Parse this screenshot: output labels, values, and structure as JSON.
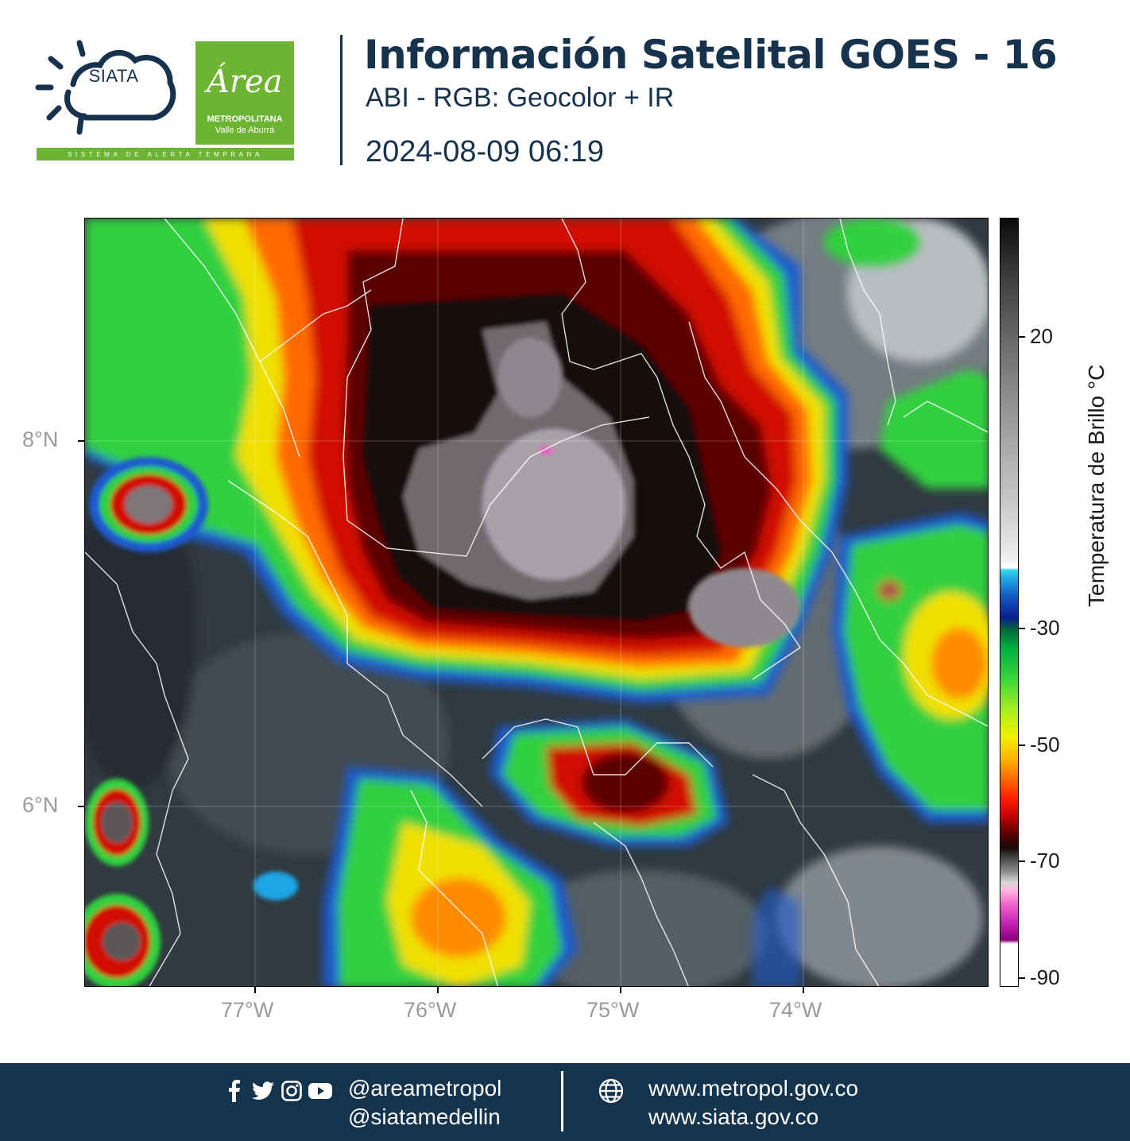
{
  "header": {
    "siata_text": "SIATA",
    "area_script": "Área",
    "area_line1": "METROPOLITANA",
    "area_line2": "Valle de Aburrá",
    "alert_band": "SISTEMA DE ALERTA TEMPRANA",
    "title": "Información Satelital GOES - 16",
    "subtitle": "ABI - RGB: Geocolor + IR",
    "datetime": "2024-08-09 06:19"
  },
  "map": {
    "lat_ticks": [
      "8°N",
      "6°N"
    ],
    "lon_ticks": [
      "77°W",
      "76°W",
      "75°W",
      "74°W"
    ],
    "colorbar": {
      "title": "Temperatura de Brillo °C",
      "ticks": [
        "20",
        "-30",
        "-50",
        "-70",
        "-90"
      ]
    },
    "colors": {
      "overshoot": "#e060c0",
      "cold_top": "#8a8a8a",
      "red_band": "#d01000",
      "green_band": "#30d040",
      "yellow_band": "#f0e000",
      "blue_edge": "#1a5ad0",
      "clear": "#303a40"
    }
  },
  "footer": {
    "icons": [
      "facebook-icon",
      "twitter-icon",
      "instagram-icon",
      "youtube-icon"
    ],
    "handle_1": "@areametropol",
    "handle_2": "@siatamedellin",
    "web_1": "www.metropol.gov.co",
    "web_2": "www.siata.gov.co"
  }
}
